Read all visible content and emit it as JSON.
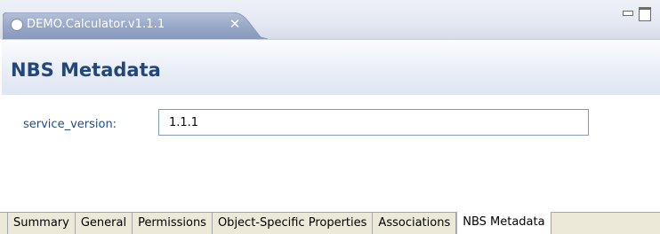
{
  "editor": {
    "tab_title": "DEMO.Calculator.v1.1.1",
    "tab_icon": "circle-icon",
    "close_glyph": "✕",
    "active_tab_color": "#9aaac8"
  },
  "form": {
    "title": "NBS Metadata",
    "title_color": "#23477b",
    "label": "service_version:",
    "label_color": "#1f4d8c",
    "value": "1.1.1"
  },
  "page_tabs": [
    {
      "label": "Summary",
      "active": false
    },
    {
      "label": "General",
      "active": false
    },
    {
      "label": "Permissions",
      "active": false
    },
    {
      "label": "Object-Specific Properties",
      "active": false
    },
    {
      "label": "Associations",
      "active": false
    },
    {
      "label": "NBS Metadata",
      "active": true
    }
  ]
}
